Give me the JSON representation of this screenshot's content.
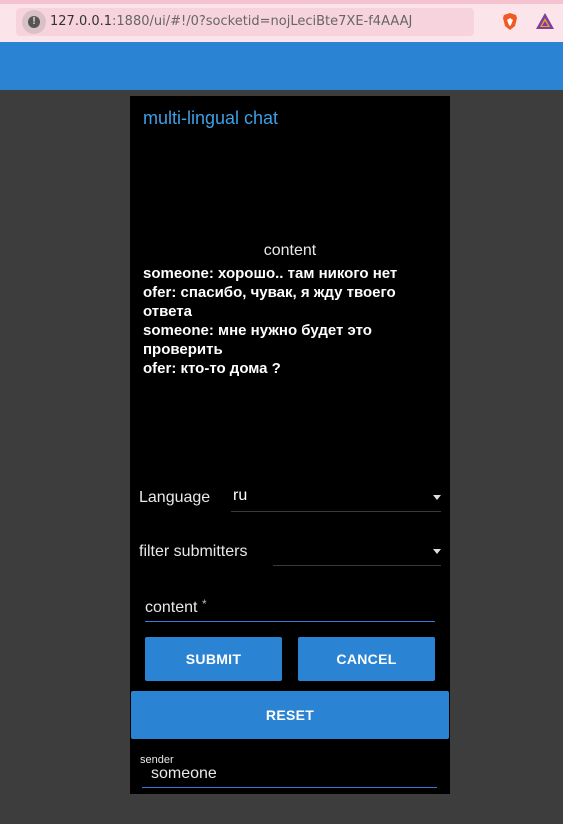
{
  "browser": {
    "url_host": "127.0.0.1",
    "url_rest": ":1880/ui/#!/0?socketid=nojLeciBte7XE-f4AAAJ"
  },
  "chat": {
    "title": "multi-lingual chat",
    "content_label": "content",
    "messages": [
      "someone: хорошо.. там никого нет",
      "ofer: спасибо, чувак, я жду твоего ответа",
      "someone: мне нужно будет это проверить",
      "ofer: кто-то дома ?"
    ]
  },
  "language": {
    "label": "Language",
    "value": "ru"
  },
  "filter": {
    "label": "filter submitters",
    "value": ""
  },
  "content_input": {
    "placeholder": "content",
    "required_mark": "*"
  },
  "buttons": {
    "submit": "SUBMIT",
    "cancel": "CANCEL",
    "reset": "RESET"
  },
  "sender": {
    "label": "sender",
    "value": "someone"
  },
  "colors": {
    "accent": "#2a84d3",
    "title": "#3e9fe6",
    "panel": "#000000",
    "page": "#3d3d3d"
  }
}
